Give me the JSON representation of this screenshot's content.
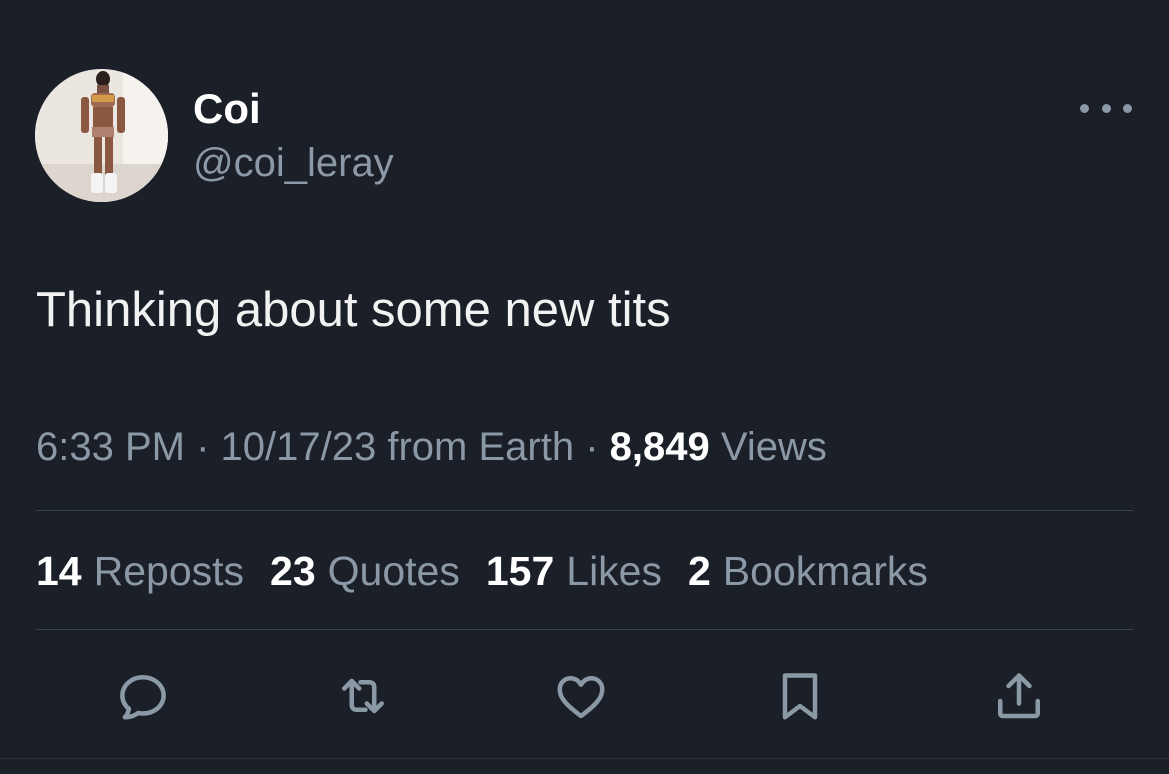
{
  "author": {
    "display_name": "Coi",
    "handle": "@coi_leray",
    "avatar_icon": "profile-photo"
  },
  "tweet": {
    "text": "Thinking about some new tits"
  },
  "meta": {
    "time": "6:33 PM",
    "separator": "·",
    "date": "10/17/23",
    "source": "from Earth",
    "views_count": "8,849",
    "views_label": "Views"
  },
  "stats": [
    {
      "count": "14",
      "label": "Reposts"
    },
    {
      "count": "23",
      "label": "Quotes"
    },
    {
      "count": "157",
      "label": "Likes"
    },
    {
      "count": "2",
      "label": "Bookmarks"
    }
  ],
  "actions": [
    {
      "name": "reply",
      "icon": "reply-icon"
    },
    {
      "name": "repost",
      "icon": "repost-icon"
    },
    {
      "name": "like",
      "icon": "heart-icon"
    },
    {
      "name": "bookmark",
      "icon": "bookmark-icon"
    },
    {
      "name": "share",
      "icon": "share-icon"
    }
  ],
  "colors": {
    "background": "#1a1f28",
    "primary_text": "#ffffff",
    "secondary_text": "#8b98a5",
    "divider": "#38424d"
  }
}
